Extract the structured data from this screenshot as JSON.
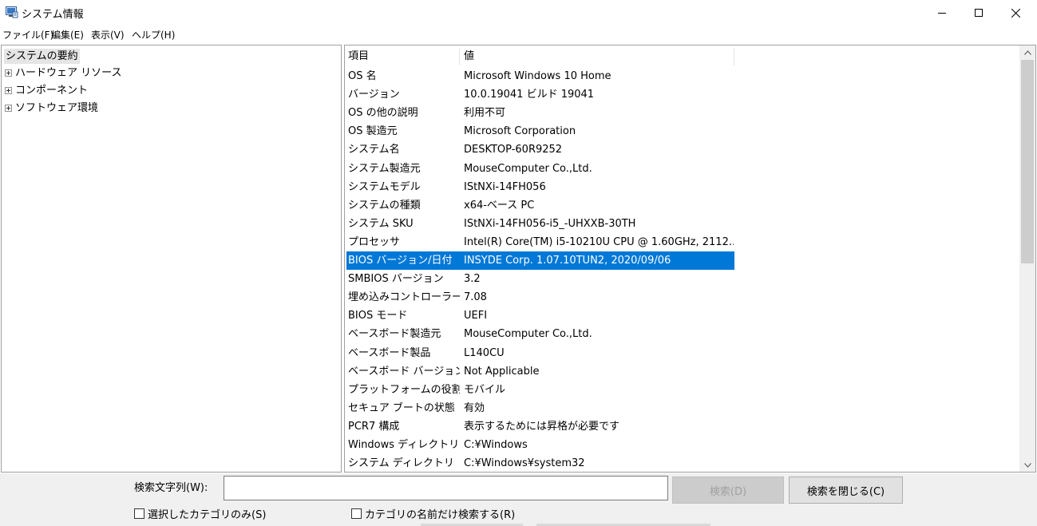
{
  "window": {
    "title": "システム情報",
    "app_icon": "system-information-icon",
    "controls": [
      "minimize-icon",
      "maximize-icon",
      "close-icon"
    ]
  },
  "menu": {
    "items": [
      "ファイル(F)",
      "編集(E)",
      "表示(V)",
      "ヘルプ(H)"
    ]
  },
  "tree": {
    "root": "システムの要約",
    "items": [
      "ハードウェア リソース",
      "コンポーネント",
      "ソフトウェア環境"
    ]
  },
  "table": {
    "headers": [
      "項目",
      "値"
    ],
    "rows": [
      {
        "key": "OS 名",
        "value": "Microsoft Windows 10 Home"
      },
      {
        "key": "バージョン",
        "value": "10.0.19041 ビルド 19041"
      },
      {
        "key": "OS の他の説明",
        "value": "利用不可"
      },
      {
        "key": "OS 製造元",
        "value": "Microsoft Corporation"
      },
      {
        "key": "システム名",
        "value": "DESKTOP-60R9252"
      },
      {
        "key": "システム製造元",
        "value": "MouseComputer Co.,Ltd."
      },
      {
        "key": "システムモデル",
        "value": "IStNXi-14FH056"
      },
      {
        "key": "システムの種類",
        "value": "x64-ベース PC"
      },
      {
        "key": "システム SKU",
        "value": "IStNXi-14FH056-i5_-UHXXB-30TH"
      },
      {
        "key": "プロセッサ",
        "value": "Intel(R) Core(TM) i5-10210U CPU @ 1.60GHz, 2112..."
      },
      {
        "key": "BIOS バージョン/日付",
        "value": "INSYDE Corp. 1.07.10TUN2, 2020/09/06"
      },
      {
        "key": "SMBIOS バージョン",
        "value": "3.2"
      },
      {
        "key": "埋め込みコントローラー...",
        "value": "7.08"
      },
      {
        "key": "BIOS モード",
        "value": "UEFI"
      },
      {
        "key": "ベースボード製造元",
        "value": "MouseComputer Co.,Ltd."
      },
      {
        "key": "ベースボード製品",
        "value": "L140CU"
      },
      {
        "key": "ベースボード バージョン",
        "value": "Not Applicable"
      },
      {
        "key": "プラットフォームの役割",
        "value": "モバイル"
      },
      {
        "key": "セキュア ブートの状態",
        "value": "有効"
      },
      {
        "key": "PCR7 構成",
        "value": "表示するためには昇格が必要です"
      },
      {
        "key": "Windows ディレクトリ",
        "value": "C:¥Windows"
      },
      {
        "key": "システム ディレクトリ",
        "value": "C:¥Windows¥system32"
      }
    ],
    "selected_index": 10,
    "selected_color": "#0078d7"
  },
  "search": {
    "label": "検索文字列(W):",
    "value": "",
    "search_button": "検索(D)",
    "close_button": "検索を閉じる(C)",
    "selected_category_only": "選択したカテゴリのみ(S)",
    "category_names_only": "カテゴリの名前だけ検索する(R)"
  }
}
